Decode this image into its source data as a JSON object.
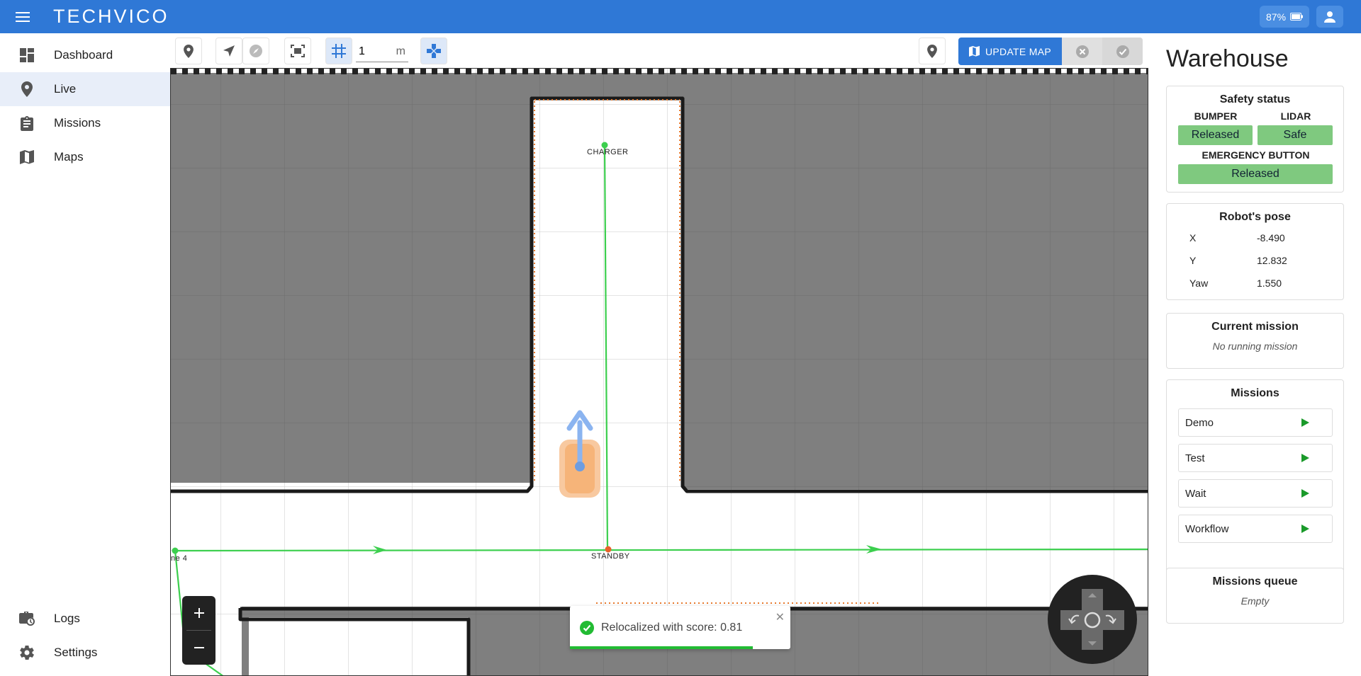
{
  "header": {
    "logo": "TECHVICO",
    "battery": "87%"
  },
  "sidebar": {
    "items": [
      {
        "label": "Dashboard",
        "icon": "dashboard-icon"
      },
      {
        "label": "Live",
        "icon": "location-pin-icon",
        "active": true
      },
      {
        "label": "Missions",
        "icon": "clipboard-icon"
      },
      {
        "label": "Maps",
        "icon": "map-icon"
      }
    ],
    "bottom_items": [
      {
        "label": "Logs",
        "icon": "logs-icon"
      },
      {
        "label": "Settings",
        "icon": "gear-icon"
      }
    ]
  },
  "toolbar": {
    "grid_size_value": "1",
    "grid_unit": "m",
    "update_map_label": "UPDATE MAP"
  },
  "map": {
    "labels": {
      "charger": "CHARGER",
      "standby": "STANDBY",
      "partial_left": "ne 4"
    },
    "toast": {
      "message": "Relocalized with score: 0.81",
      "progress": 0.83
    },
    "colors": {
      "path": "#3ccf4e",
      "robot": "#f4a259",
      "heading": "#8bb4f0",
      "occupied": "#7f7f7f"
    }
  },
  "panel": {
    "title": "Warehouse",
    "safety": {
      "title": "Safety status",
      "bumper_label": "BUMPER",
      "bumper_value": "Released",
      "lidar_label": "LIDAR",
      "lidar_value": "Safe",
      "emergency_label": "EMERGENCY BUTTON",
      "emergency_value": "Released"
    },
    "pose": {
      "title": "Robot's pose",
      "rows": [
        {
          "label": "X",
          "value": "-8.490"
        },
        {
          "label": "Y",
          "value": "12.832"
        },
        {
          "label": "Yaw",
          "value": "1.550"
        }
      ]
    },
    "current_mission": {
      "title": "Current mission",
      "value": "No running mission"
    },
    "missions": {
      "title": "Missions",
      "items": [
        "Demo",
        "Test",
        "Wait",
        "Workflow"
      ]
    },
    "queue": {
      "title": "Missions queue",
      "value": "Empty"
    }
  }
}
